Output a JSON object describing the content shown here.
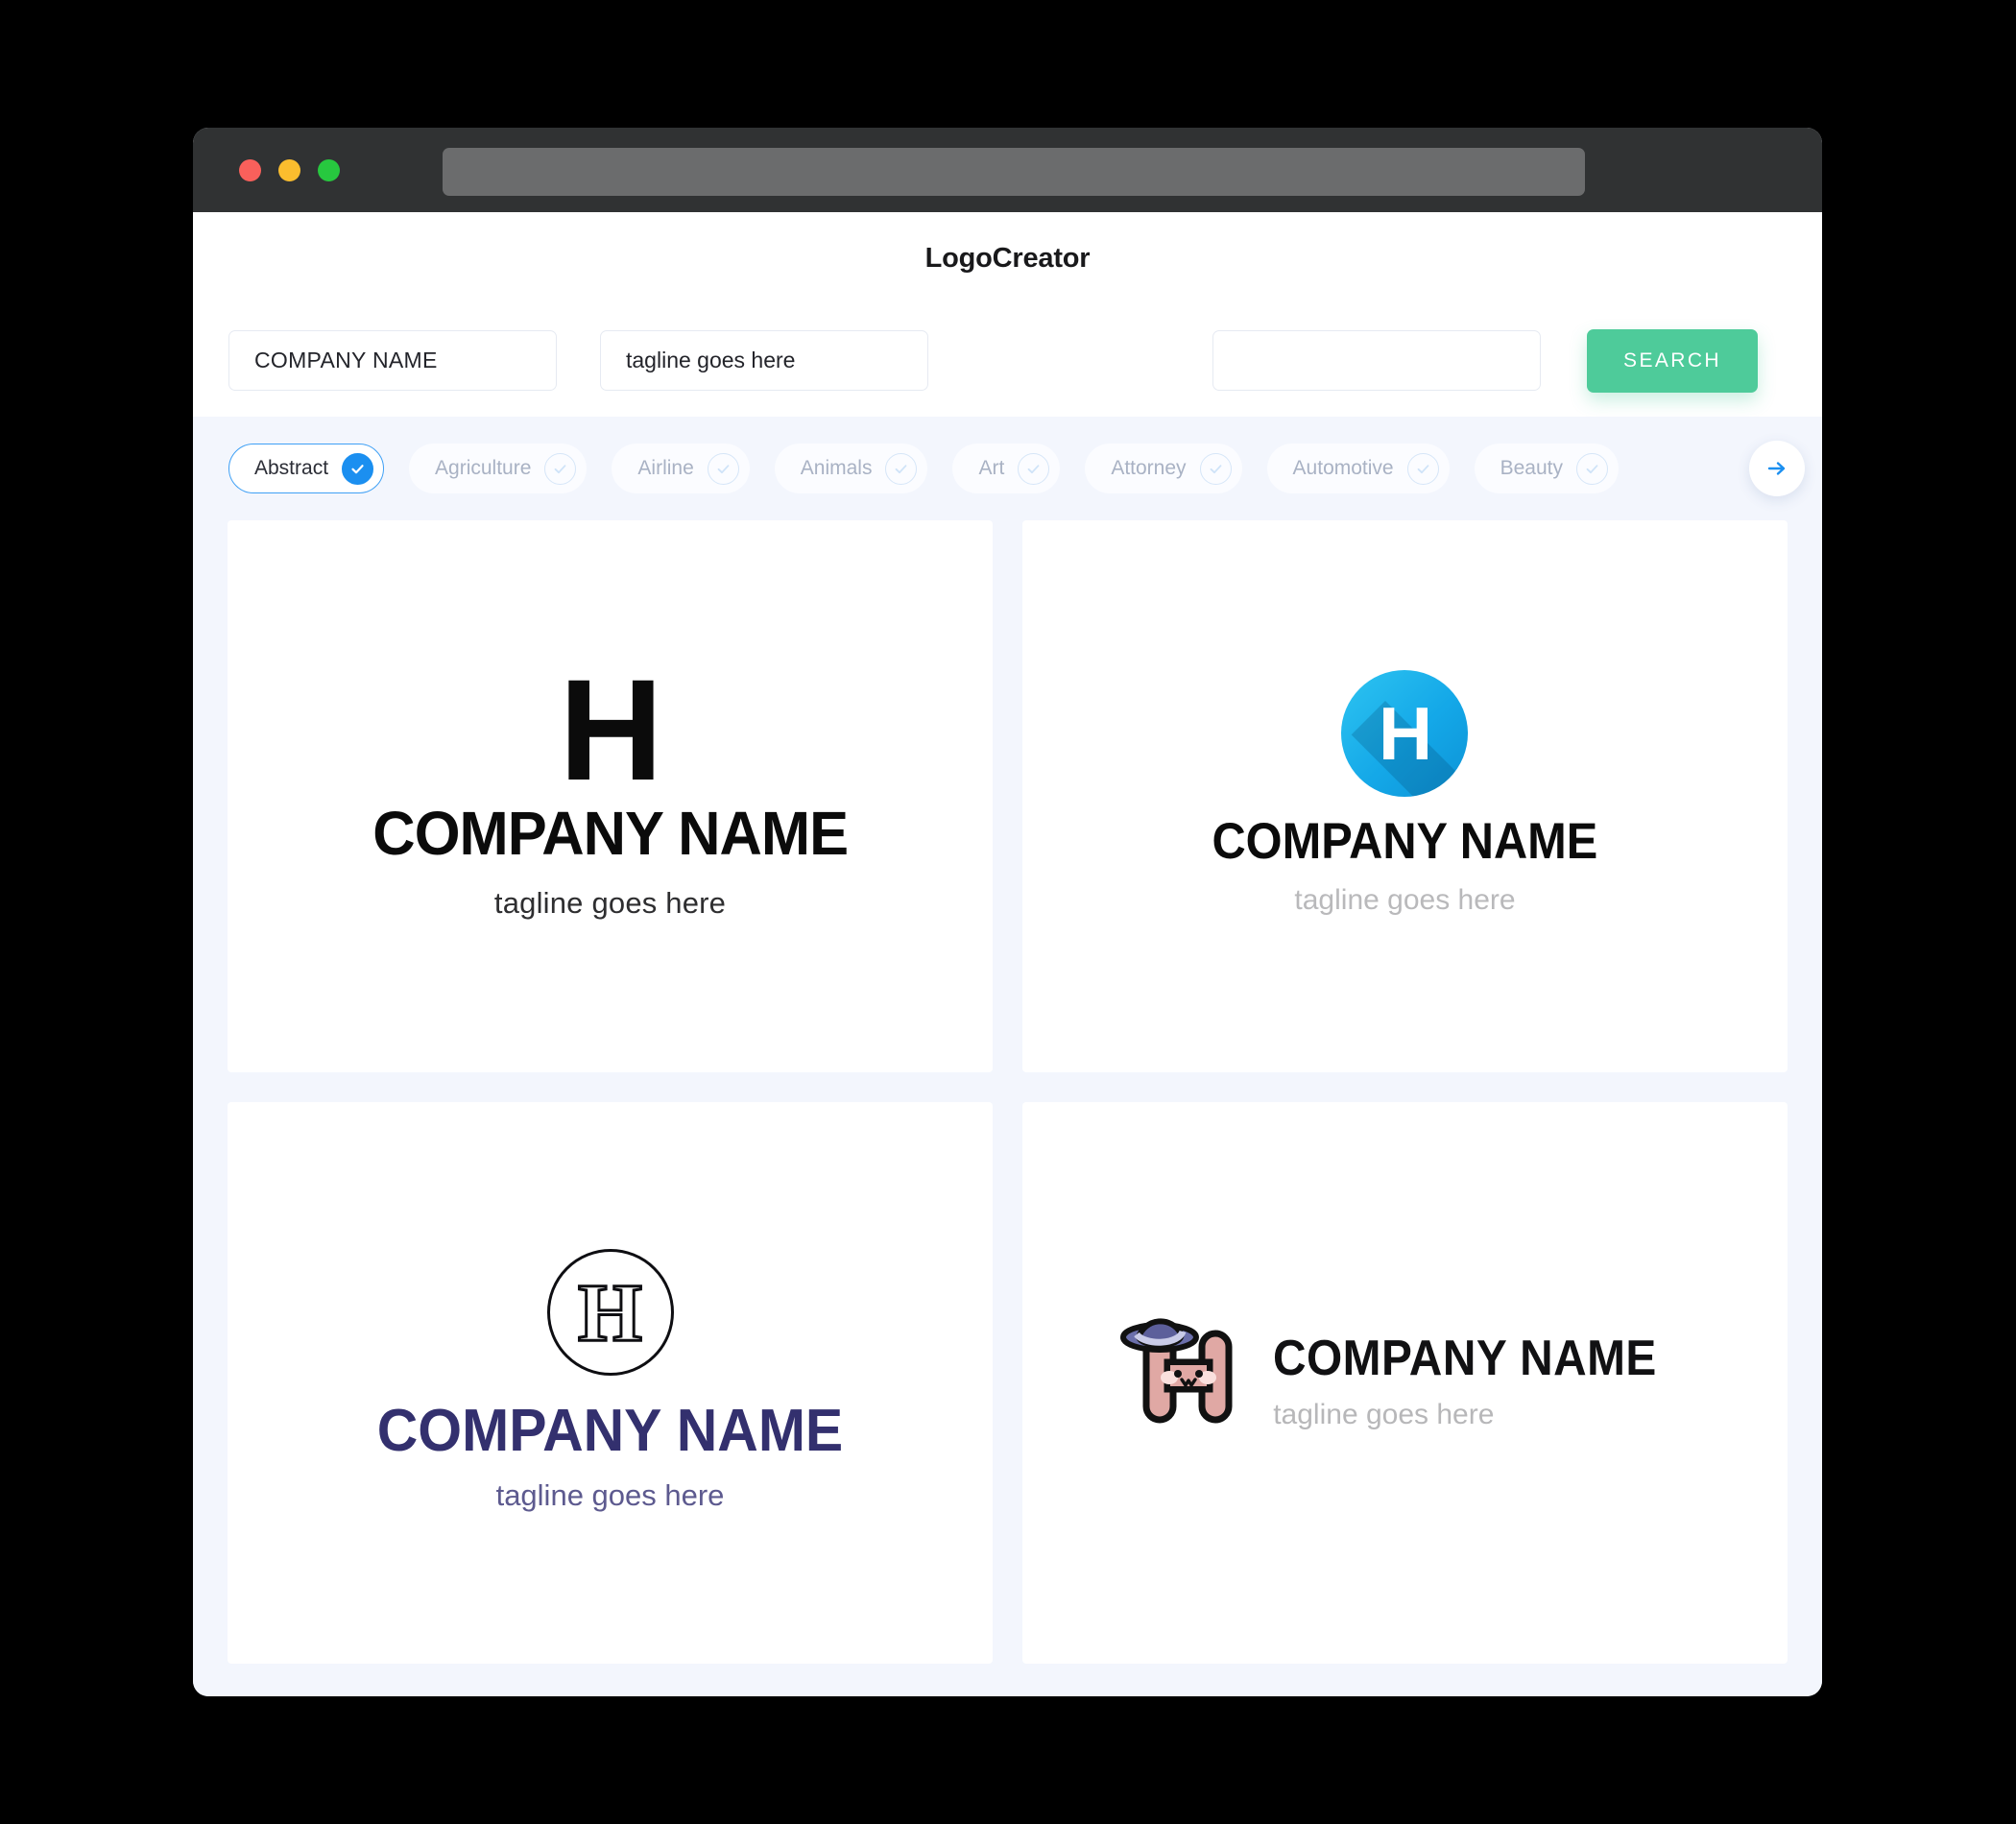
{
  "window": {
    "traffic_lights": [
      "close",
      "minimize",
      "maximize"
    ],
    "url_value": ""
  },
  "header": {
    "app_title": "LogoCreator"
  },
  "search": {
    "company_value": "COMPANY NAME",
    "company_placeholder": "COMPANY NAME",
    "tagline_value": "tagline goes here",
    "tagline_placeholder": "tagline goes here",
    "extra_value": "",
    "extra_placeholder": "",
    "search_button": "SEARCH"
  },
  "categories": {
    "next_icon": "arrow-right-icon",
    "items": [
      {
        "label": "Abstract",
        "selected": true
      },
      {
        "label": "Agriculture",
        "selected": false
      },
      {
        "label": "Airline",
        "selected": false
      },
      {
        "label": "Animals",
        "selected": false
      },
      {
        "label": "Art",
        "selected": false
      },
      {
        "label": "Attorney",
        "selected": false
      },
      {
        "label": "Automotive",
        "selected": false
      },
      {
        "label": "Beauty",
        "selected": false
      }
    ]
  },
  "results": [
    {
      "style": "bold-block",
      "initial": "H",
      "name": "COMPANY NAME",
      "tagline": "tagline goes here",
      "name_color": "#0b0b0b",
      "tagline_color": "#2e2e30"
    },
    {
      "style": "blue-circle-longshadow",
      "initial": "H",
      "name": "COMPANY NAME",
      "tagline": "tagline goes here",
      "mark_color": "#17abe8",
      "name_color": "#0b0b0b",
      "tagline_color": "#b9b9bb"
    },
    {
      "style": "outline-crest",
      "initial": "H",
      "name": "COMPANY NAME",
      "tagline": "tagline goes here",
      "name_color": "#33306e",
      "tagline_color": "#5d5a8f"
    },
    {
      "style": "cute-character-hat",
      "initial": "H",
      "name": "COMPANY NAME",
      "tagline": "tagline goes here",
      "mark_color": "#e0a8a4",
      "hat_color": "#6b6fab",
      "name_color": "#111113",
      "tagline_color": "#b7b7b9"
    }
  ],
  "colors": {
    "page_bg": "#f3f6fd",
    "accent_green": "#4ecb9a",
    "accent_blue": "#1b8ff0",
    "titlebar": "#303233"
  }
}
